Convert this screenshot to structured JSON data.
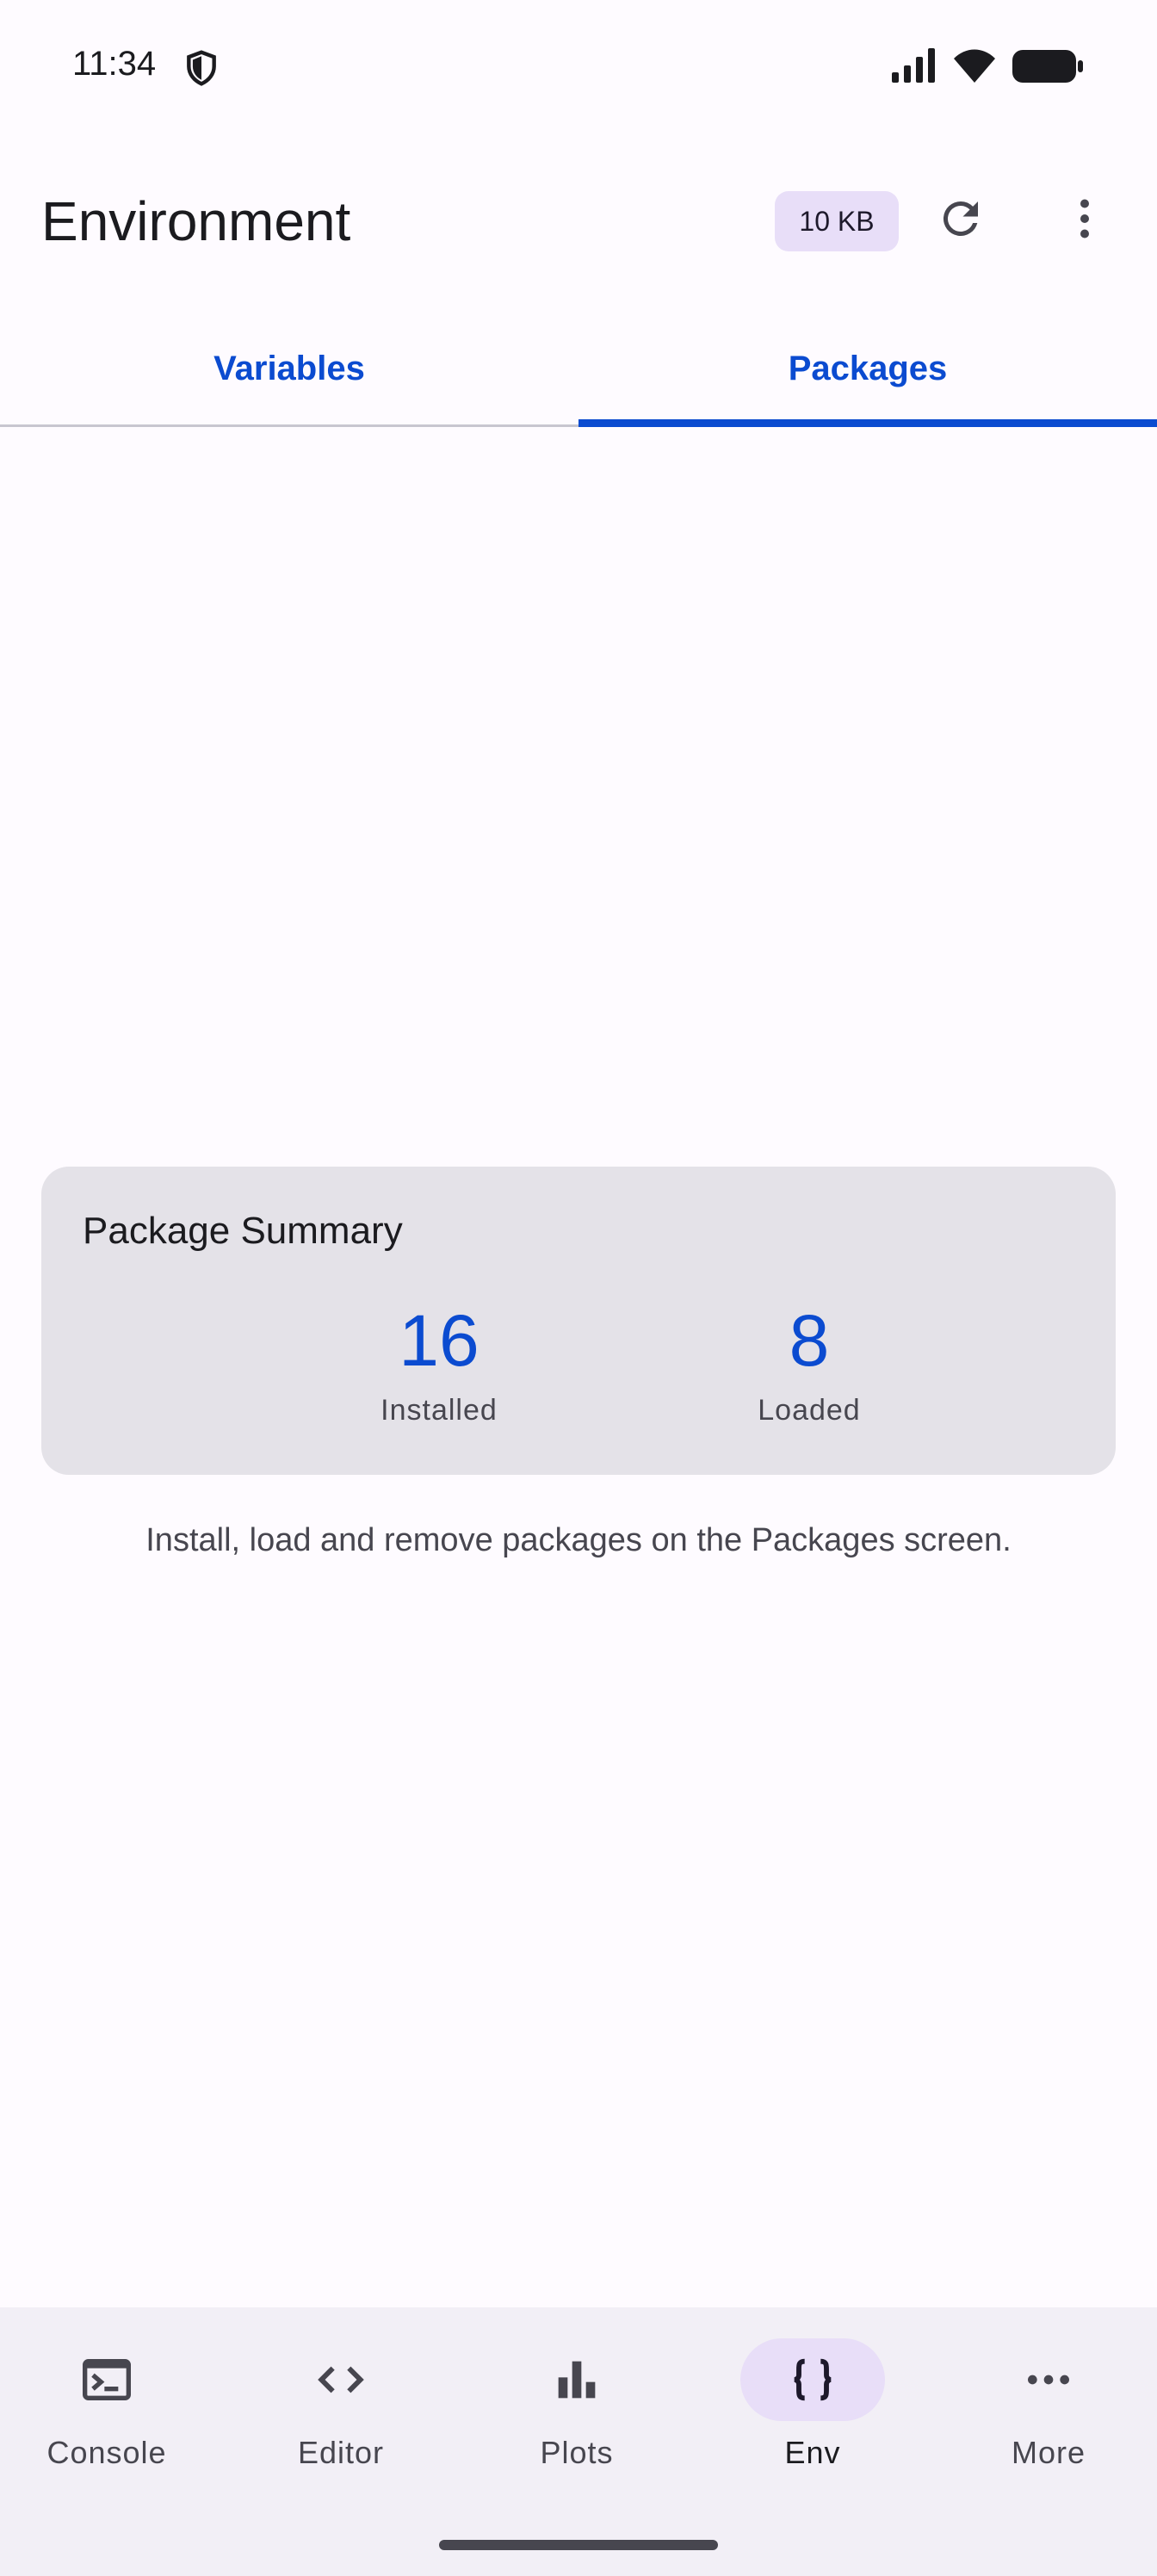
{
  "status_bar": {
    "time": "11:34",
    "icons": [
      "shield-icon",
      "signal-icon",
      "wifi-icon",
      "battery-icon"
    ]
  },
  "app_bar": {
    "title": "Environment",
    "memory_chip": "10 KB",
    "refresh_icon": "refresh-icon",
    "menu_icon": "more-vert-icon"
  },
  "tabs": [
    {
      "label": "Variables",
      "selected": false
    },
    {
      "label": "Packages",
      "selected": true
    }
  ],
  "summary": {
    "title": "Package Summary",
    "installed_value": "16",
    "installed_label": "Installed",
    "loaded_value": "8",
    "loaded_label": "Loaded"
  },
  "help_text": "Install, load and remove packages on the Packages screen.",
  "bottom_nav": {
    "items": [
      {
        "label": "Console",
        "icon": "terminal-icon",
        "active": false
      },
      {
        "label": "Editor",
        "icon": "code-icon",
        "active": false
      },
      {
        "label": "Plots",
        "icon": "bar-chart-icon",
        "active": false
      },
      {
        "label": "Env",
        "icon": "braces-icon",
        "active": true
      },
      {
        "label": "More",
        "icon": "more-horiz-icon",
        "active": false
      }
    ]
  },
  "colors": {
    "accent": "#0b4bd0",
    "chip_bg": "#e8def8",
    "card_bg": "#e4e2e8",
    "nav_bg": "#f2eff6"
  }
}
